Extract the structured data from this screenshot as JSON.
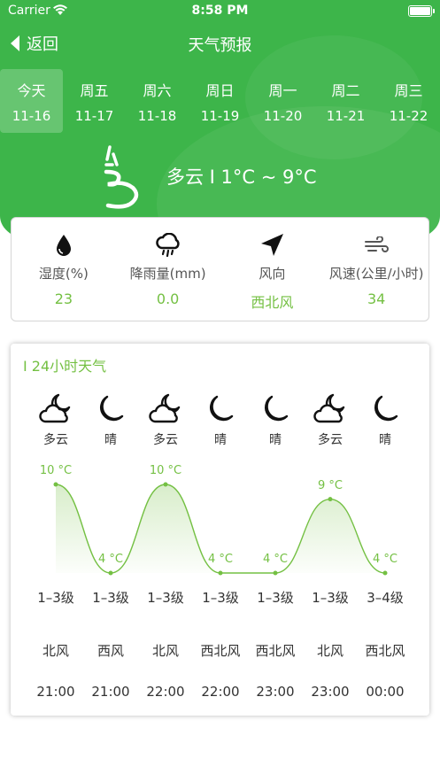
{
  "colors": {
    "brand_green": "#3db54a",
    "accent_green": "#74c043"
  },
  "status_bar": {
    "carrier": "Carrier",
    "time": "8:58 PM"
  },
  "nav": {
    "back_label": "返回",
    "title": "天气预报"
  },
  "days": [
    {
      "weekday": "今天",
      "date": "11-16",
      "active": true
    },
    {
      "weekday": "周五",
      "date": "11-17"
    },
    {
      "weekday": "周六",
      "date": "11-18"
    },
    {
      "weekday": "周日",
      "date": "11-19"
    },
    {
      "weekday": "周一",
      "date": "11-20"
    },
    {
      "weekday": "周二",
      "date": "11-21"
    },
    {
      "weekday": "周三",
      "date": "11-22"
    }
  ],
  "today": {
    "summary": "多云 I 1°C ~ 9°C",
    "icon": "cloudy-wind-icon"
  },
  "stats": [
    {
      "icon": "humidity-drop-icon",
      "label": "湿度(%)",
      "value": "23"
    },
    {
      "icon": "rain-cloud-icon",
      "label": "降雨量(mm)",
      "value": "0.0"
    },
    {
      "icon": "wind-direction-arrow-icon",
      "label": "风向",
      "value": "西北风"
    },
    {
      "icon": "wind-speed-icon",
      "label": "风速(公里/小时)",
      "value": "34"
    }
  ],
  "hourly": {
    "title": "I 24小时天气",
    "items": [
      {
        "icon": "cloudy-night-icon",
        "condition": "多云",
        "temp": "10 °C",
        "level": "1–3级",
        "direction": "北风",
        "time": "21:00"
      },
      {
        "icon": "moon-icon",
        "condition": "晴",
        "temp": "4 °C",
        "level": "1–3级",
        "direction": "西风",
        "time": "21:00"
      },
      {
        "icon": "cloudy-night-icon",
        "condition": "多云",
        "temp": "10 °C",
        "level": "1–3级",
        "direction": "北风",
        "time": "22:00"
      },
      {
        "icon": "moon-icon",
        "condition": "晴",
        "temp": "4 °C",
        "level": "1–3级",
        "direction": "西北风",
        "time": "22:00"
      },
      {
        "icon": "moon-icon",
        "condition": "晴",
        "temp": "4 °C",
        "level": "1–3级",
        "direction": "西北风",
        "time": "23:00"
      },
      {
        "icon": "cloudy-night-icon",
        "condition": "多云",
        "temp": "9 °C",
        "level": "1–3级",
        "direction": "北风",
        "time": "23:00"
      },
      {
        "icon": "moon-icon",
        "condition": "晴",
        "temp": "4 °C",
        "level": "3–4级",
        "direction": "西北风",
        "time": "00:00"
      }
    ]
  },
  "chart_data": {
    "type": "area",
    "x": [
      "21:00",
      "21:00",
      "22:00",
      "22:00",
      "23:00",
      "23:00",
      "00:00"
    ],
    "series": [
      {
        "values": [
          10,
          4,
          10,
          4,
          4,
          9,
          4
        ]
      }
    ],
    "ylim": [
      4,
      10
    ]
  }
}
